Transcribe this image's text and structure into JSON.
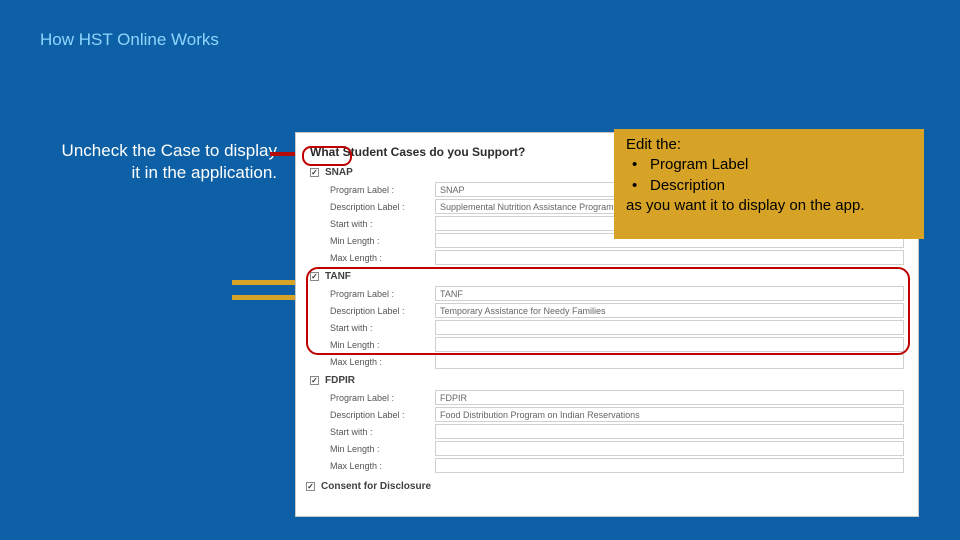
{
  "slide": {
    "title": "How HST Online Works"
  },
  "left_callout": {
    "line1": "Uncheck the Case to display",
    "line2": "it in the application."
  },
  "panel": {
    "title": "What Student Cases do you Support?",
    "sections": [
      {
        "name": "SNAP",
        "checked": true,
        "fields": {
          "program_label_label": "Program Label :",
          "program_label_value": "SNAP",
          "description_label_label": "Description Label :",
          "description_label_value": "Supplemental Nutrition Assistance Programs",
          "start_with_label": "Start with :",
          "min_length_label": "Min Length :",
          "max_length_label": "Max Length :"
        }
      },
      {
        "name": "TANF",
        "checked": true,
        "fields": {
          "program_label_label": "Program Label :",
          "program_label_value": "TANF",
          "description_label_label": "Description Label :",
          "description_label_value": "Temporary Assistance for Needy Families",
          "start_with_label": "Start with :",
          "min_length_label": "Min Length :",
          "max_length_label": "Max Length :"
        }
      },
      {
        "name": "FDPIR",
        "checked": true,
        "fields": {
          "program_label_label": "Program Label :",
          "program_label_value": "FDPIR",
          "description_label_label": "Description Label :",
          "description_label_value": "Food Distribution Program on Indian Reservations",
          "start_with_label": "Start with :",
          "min_length_label": "Min Length :",
          "max_length_label": "Max Length :"
        }
      }
    ],
    "consent": {
      "label": "Consent for Disclosure",
      "checked": true
    }
  },
  "gold_box": {
    "line1": "Edit the:",
    "bullet1": "Program Label",
    "bullet2": "Description",
    "line4": "as you want it to display on the app."
  },
  "glyphs": {
    "check": "✓",
    "bullet": "•"
  }
}
